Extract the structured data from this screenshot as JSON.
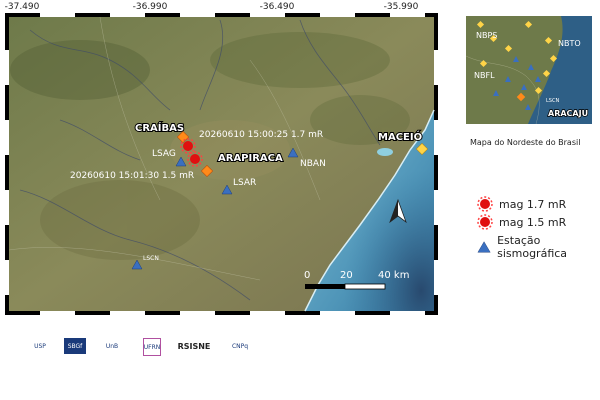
{
  "coords": [
    "-37.490",
    "-36.990",
    "-36.490",
    "-35.990"
  ],
  "map": {
    "places": {
      "craibas": "CRAÍBAS",
      "arapiraca": "ARAPIRACA",
      "maceio": "MACEIÓ",
      "lsag": "LSAG",
      "lsar": "LSAR",
      "nban": "NBAN",
      "lscn": "LSCN"
    },
    "events": [
      {
        "label": "20260610 15:00:25 1.7 mR"
      },
      {
        "label": "20260610 15:01:30 1.5 mR"
      }
    ],
    "scale": {
      "t0": "0",
      "t1": "20",
      "t2": "40 km"
    }
  },
  "inset": {
    "labels": {
      "nbps": "NBPS",
      "nbto": "NBTO",
      "nbfl": "NBFL",
      "lscn": "LSCN",
      "aracaju": "ARACAJU"
    },
    "caption": "Mapa do Nordeste do Brasil"
  },
  "legend": {
    "mag17": "mag 1.7 mR",
    "mag15": "mag 1.5 mR",
    "station": "Estação sismográfica"
  },
  "logos": [
    "USP",
    "SBGf",
    "UnB",
    "UFRN",
    "RSISNE",
    "CNPq"
  ],
  "colors": {
    "event": "#e01010",
    "station": "#3a6fc0",
    "city": "#ff8a1a",
    "ocean": "#5fa9c8"
  }
}
